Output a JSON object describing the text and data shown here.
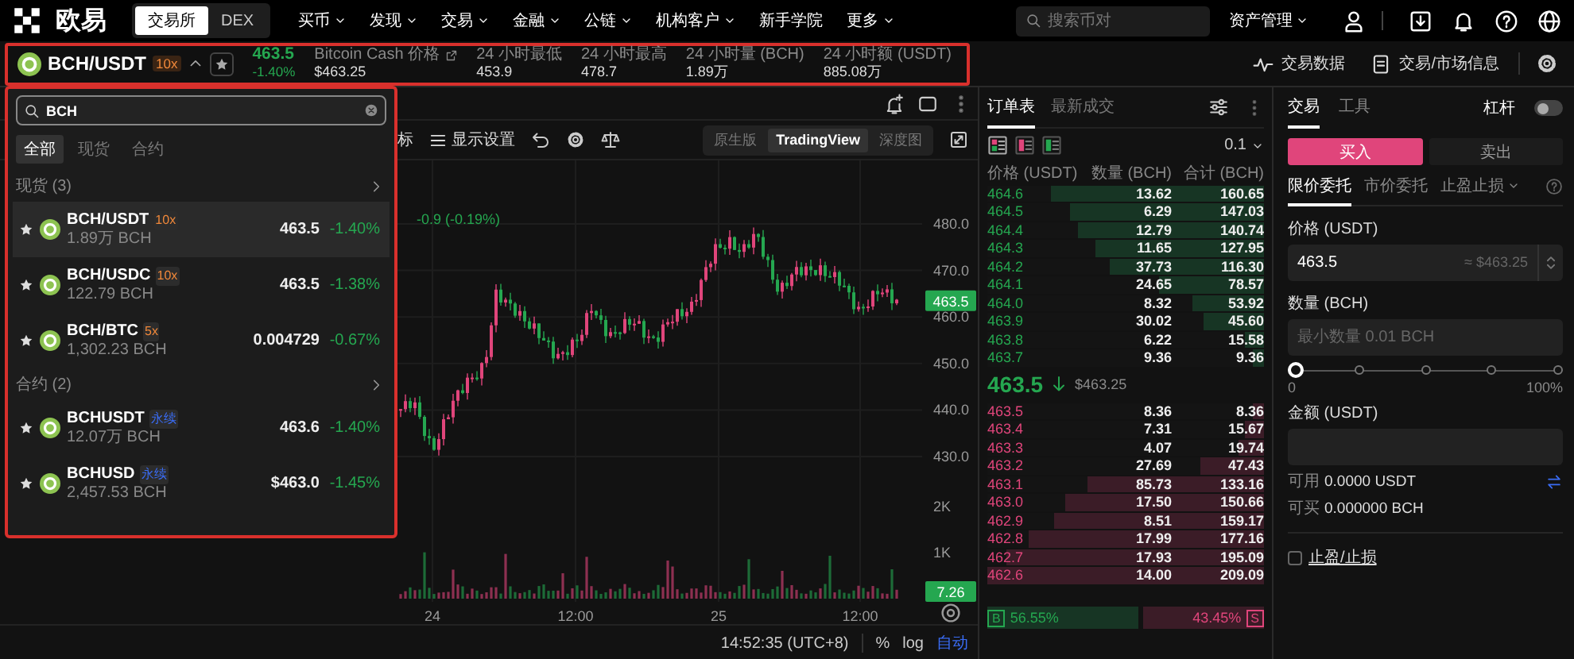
{
  "nav": {
    "logo": "欧易",
    "modes": [
      {
        "label": "交易所",
        "selected": true
      },
      {
        "label": "DEX",
        "selected": false
      }
    ],
    "menu": [
      {
        "label": "买币",
        "dropdown": true
      },
      {
        "label": "发现",
        "dropdown": true
      },
      {
        "label": "交易",
        "dropdown": true
      },
      {
        "label": "金融",
        "dropdown": true
      },
      {
        "label": "公链",
        "dropdown": true
      },
      {
        "label": "机构客户",
        "dropdown": true
      },
      {
        "label": "新手学院",
        "dropdown": false
      },
      {
        "label": "更多",
        "dropdown": true
      }
    ],
    "search": {
      "placeholder": "搜索币对"
    },
    "assets": "资产管理"
  },
  "ticker": {
    "pair": "BCH/USDT",
    "leverage": "10x",
    "price": "463.5",
    "change": "-1.40%",
    "index_label": "Bitcoin Cash 价格",
    "index_price": "$463.25",
    "stats": [
      {
        "label": "24 小时最低",
        "value": "453.9"
      },
      {
        "label": "24 小时最高",
        "value": "478.7"
      },
      {
        "label": "24 小时量 (BCH)",
        "value": "1.89万"
      },
      {
        "label": "24 小时额 (USDT)",
        "value": "885.08万"
      }
    ],
    "links": [
      {
        "label": "交易数据"
      },
      {
        "label": "交易/市场信息"
      }
    ]
  },
  "pair_search": {
    "query": "BCH",
    "tabs": [
      {
        "label": "全部",
        "selected": true
      },
      {
        "label": "现货",
        "selected": false
      },
      {
        "label": "合约",
        "selected": false
      }
    ],
    "groups": [
      {
        "title": "现货 (3)",
        "rows": [
          {
            "pair": "BCH/USDT",
            "badge": "10x",
            "color": "#f0883a",
            "volume": "1.89万 BCH",
            "price": "463.5",
            "change": "-1.40%",
            "selected": true
          },
          {
            "pair": "BCH/USDC",
            "badge": "10x",
            "color": "#f0883a",
            "volume": "122.79 BCH",
            "price": "463.5",
            "change": "-1.38%",
            "selected": false
          },
          {
            "pair": "BCH/BTC",
            "badge": "5x",
            "color": "#f0883a",
            "volume": "1,302.23 BCH",
            "price": "0.004729",
            "change": "-0.67%",
            "selected": false
          }
        ]
      },
      {
        "title": "合约 (2)",
        "rows": [
          {
            "pair": "BCHUSDT",
            "badge": "永续",
            "color": "#3a6cf4",
            "volume": "12.07万 BCH",
            "price": "463.6",
            "change": "-1.40%",
            "selected": false
          },
          {
            "pair": "BCHUSD",
            "badge": "永续",
            "color": "#3a6cf4",
            "volume": "2,457.53 BCH",
            "price": "$463.0",
            "change": "-1.45%",
            "selected": false
          }
        ]
      }
    ]
  },
  "chart": {
    "indicators_label": "标",
    "display_settings": "显示设置",
    "views": [
      {
        "label": "原生版",
        "selected": false
      },
      {
        "label": "TradingView",
        "selected": true
      },
      {
        "label": "深度图",
        "selected": false
      }
    ],
    "legend": "-0.9 (-0.19%)",
    "y_labels": [
      "480.0",
      "470.0",
      "460.0",
      "450.0",
      "440.0",
      "430.0"
    ],
    "volume_labels": [
      "2K",
      "1K"
    ],
    "x_labels": [
      "24",
      "12:00",
      "25",
      "12:00"
    ],
    "last_price": "463.5",
    "last_volume": "7.26",
    "clock": "14:52:35 (UTC+8)",
    "scale_options": [
      {
        "label": "%",
        "selected": false
      },
      {
        "label": "log",
        "selected": false
      },
      {
        "label": "自动",
        "selected": true
      }
    ]
  },
  "order_book": {
    "tabs": [
      {
        "label": "订单表",
        "selected": true
      },
      {
        "label": "最新成交",
        "selected": false
      }
    ],
    "precision": "0.1",
    "columns": [
      "价格 (USDT)",
      "数量 (BCH)",
      "合计 (BCH)"
    ],
    "upper_rows": [
      {
        "price": "464.6",
        "amount": "13.62",
        "total": "160.65",
        "level": 0.77
      },
      {
        "price": "464.5",
        "amount": "6.29",
        "total": "147.03",
        "level": 0.7
      },
      {
        "price": "464.4",
        "amount": "12.79",
        "total": "140.74",
        "level": 0.67
      },
      {
        "price": "464.3",
        "amount": "11.65",
        "total": "127.95",
        "level": 0.61
      },
      {
        "price": "464.2",
        "amount": "37.73",
        "total": "116.30",
        "level": 0.56
      },
      {
        "price": "464.1",
        "amount": "24.65",
        "total": "78.57",
        "level": 0.38
      },
      {
        "price": "464.0",
        "amount": "8.32",
        "total": "53.92",
        "level": 0.26
      },
      {
        "price": "463.9",
        "amount": "30.02",
        "total": "45.60",
        "level": 0.22
      },
      {
        "price": "463.8",
        "amount": "6.22",
        "total": "15.58",
        "level": 0.07
      },
      {
        "price": "463.7",
        "amount": "9.36",
        "total": "9.36",
        "level": 0.04
      }
    ],
    "mid_price": "463.5",
    "mid_usd": "$463.25",
    "lower_rows": [
      {
        "price": "463.5",
        "amount": "8.36",
        "total": "8.36",
        "level": 0.04
      },
      {
        "price": "463.4",
        "amount": "7.31",
        "total": "15.67",
        "level": 0.07
      },
      {
        "price": "463.3",
        "amount": "4.07",
        "total": "19.74",
        "level": 0.09
      },
      {
        "price": "463.2",
        "amount": "27.69",
        "total": "47.43",
        "level": 0.23
      },
      {
        "price": "463.1",
        "amount": "85.73",
        "total": "133.16",
        "level": 0.64
      },
      {
        "price": "463.0",
        "amount": "17.50",
        "total": "150.66",
        "level": 0.72
      },
      {
        "price": "462.9",
        "amount": "8.51",
        "total": "159.17",
        "level": 0.76
      },
      {
        "price": "462.8",
        "amount": "17.99",
        "total": "177.16",
        "level": 0.85
      },
      {
        "price": "462.7",
        "amount": "17.93",
        "total": "195.09",
        "level": 0.93
      },
      {
        "price": "462.6",
        "amount": "14.00",
        "total": "209.09",
        "level": 1.0
      }
    ],
    "buy_ratio": {
      "marker": "B",
      "label": "56.55%",
      "level": 0.5655
    },
    "sell_ratio": {
      "marker": "S",
      "label": "43.45%"
    }
  },
  "trade": {
    "tabs": [
      {
        "label": "交易",
        "selected": true
      },
      {
        "label": "工具",
        "selected": false
      }
    ],
    "leverage": {
      "label": "杠杆",
      "on": false
    },
    "sides": [
      {
        "label": "买入",
        "selected": true
      },
      {
        "label": "卖出",
        "selected": false
      }
    ],
    "order_types": [
      {
        "label": "限价委托",
        "selected": true,
        "dropdown": false
      },
      {
        "label": "市价委托",
        "selected": false,
        "dropdown": false
      },
      {
        "label": "止盈止损",
        "selected": false,
        "dropdown": true
      }
    ],
    "price": {
      "label": "价格 (USDT)",
      "value": "463.5",
      "hint": "≈ $463.25"
    },
    "amount": {
      "label": "数量 (BCH)",
      "placeholder": "最小数量 0.01 BCH"
    },
    "slider": {
      "level": 0,
      "min_label": "0",
      "max_label": "100%"
    },
    "total": {
      "label": "金额 (USDT)"
    },
    "available": {
      "label": "可用",
      "value": "0.0000 USDT"
    },
    "can_buy": {
      "label": "可买",
      "value": "0.000000 BCH"
    },
    "tpsl": {
      "label": "止盈/止损",
      "checked": false
    }
  }
}
